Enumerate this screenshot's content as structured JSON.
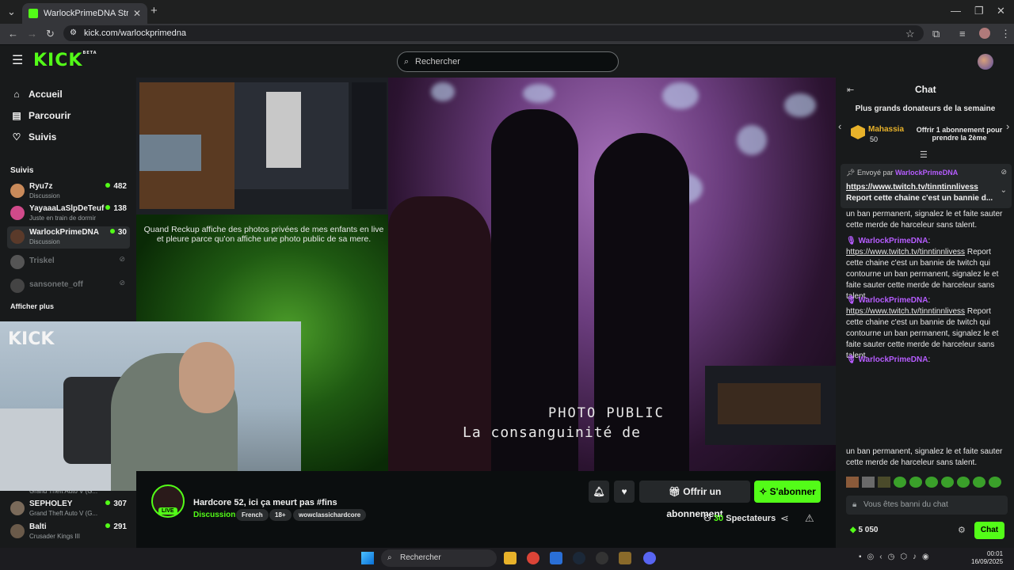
{
  "browser": {
    "tab_title": "WarlockPrimeDNA Stream - Wa",
    "url": "kick.com/warlockprimedna"
  },
  "header": {
    "logo": "KICK",
    "logo_badge": "BETA",
    "search_placeholder": "Rechercher"
  },
  "sidebar": {
    "nav": [
      {
        "label": "Accueil",
        "icon": "home-icon"
      },
      {
        "label": "Parcourir",
        "icon": "browse-icon"
      },
      {
        "label": "Suivis",
        "icon": "heart-icon"
      }
    ],
    "follows_title": "Suivis",
    "follows": [
      {
        "name": "Ryu7z",
        "category": "Discussion",
        "viewers": "482",
        "online": true,
        "color": "#c98a5a"
      },
      {
        "name": "YayaaaLaSlpDeTeuf",
        "category": "Juste en train de dormir",
        "viewers": "138",
        "online": true,
        "color": "#d04a8a"
      },
      {
        "name": "WarlockPrimeDNA",
        "category": "Discussion",
        "viewers": "30",
        "online": true,
        "color": "#5a3a2a"
      },
      {
        "name": "Triskel",
        "category": "",
        "viewers": "",
        "online": false,
        "color": "#555"
      },
      {
        "name": "sansonete_off",
        "category": "",
        "viewers": "",
        "online": false,
        "color": "#444"
      }
    ],
    "show_more": "Afficher plus",
    "more_follows": [
      {
        "name": "",
        "category": "Grand Theft Auto V (G...",
        "viewers": ""
      },
      {
        "name": "SEPHOLEY",
        "category": "Grand Theft Auto V (G...",
        "viewers": "307",
        "color": "#7a6a5a"
      },
      {
        "name": "Balti",
        "category": "Crusader Kings III",
        "viewers": "291",
        "color": "#6a5a4a"
      }
    ]
  },
  "video": {
    "caption": "Quand Reckup affiche des photos privées de mes enfants en live et pleure parce qu'on affiche une photo public de sa mere.",
    "overlay_line1": "PHOTO PUBLIC",
    "overlay_line2": "La consanguinité de",
    "cam_logo": "KICK"
  },
  "stream": {
    "title": "Hardcore 52, ici ça meurt pas #fins",
    "category": "Discussion",
    "tags": [
      "French",
      "18+",
      "wowclassichardcore"
    ],
    "live_label": "LIVE",
    "subscribe_gift": "Offrir un abonnement",
    "subscribe": "S'abonner",
    "viewers_count": "30",
    "viewers_label": "Spectateurs"
  },
  "chat": {
    "title": "Chat",
    "donors_title": "Plus grands donateurs de la semaine",
    "top_donor_name": "Mahassia",
    "top_donor_amount": "50",
    "offer_text": "Offrir 1 abonnement pour prendre la 2ème",
    "pinned_by_label": "Envoyé par",
    "pinned_user": "WarlockPrimeDNA",
    "pinned_link": "https://www.twitch.tv/tinntinnlivess",
    "pinned_text": "Report cette chaine c'est un bannie d...",
    "msg0_tail": "un ban permanent, signalez le et faite sauter cette merde de harceleur sans talent.",
    "messages": [
      {
        "user": "WarlockPrimeDNA",
        "link": "https://www.twitch.tv/tinntinnlivess",
        "text": "Report cette chaine c'est un bannie de twitch qui contourne un ban permanent, signalez le et faite sauter cette merde de harceleur sans talent."
      },
      {
        "user": "WarlockPrimeDNA",
        "link": "https://www.twitch.tv/tinntinnlivess",
        "text": "Report cette chaine c'est un bannie de twitch qui contourne un ban permanent, signalez le et faite sauter cette merde de harceleur sans talent."
      },
      {
        "user": "WarlockPrimeDNA",
        "link": "",
        "text": ""
      }
    ],
    "last_tail": "un ban permanent, signalez le et faite sauter cette merde de harceleur sans talent.",
    "input_placeholder": "Vous êtes banni du chat",
    "points": "5 050",
    "send": "Chat"
  },
  "taskbar": {
    "search": "Rechercher",
    "time": "00:01",
    "date": "16/09/2025"
  },
  "colors": {
    "brand": "#53fc18",
    "username": "#b65cff",
    "background": "#0b0e0f"
  }
}
